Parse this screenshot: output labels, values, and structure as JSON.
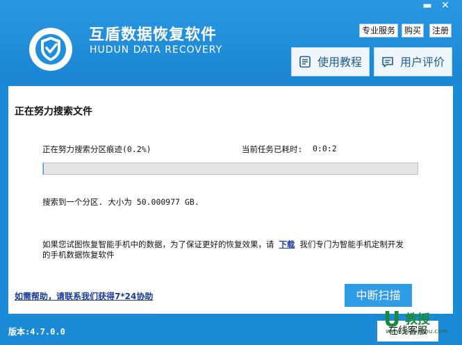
{
  "window": {
    "minimize": "▬",
    "close": "✕"
  },
  "header": {
    "app_name": "互盾数据恢复软件",
    "app_name_en": "HUDUN DATA RECOVERY",
    "links": [
      "专业服务",
      "购买",
      "注册"
    ],
    "tutorial_label": "使用教程",
    "review_label": "用户评价"
  },
  "panel": {
    "title": "正在努力搜索文件",
    "status": "正在努力搜索分区痕迹(0.2%)",
    "elapsed_label": "当前任务已耗时:",
    "elapsed_value": "0:0:2",
    "progress_percent": 0.2,
    "found": "搜索到一个分区. 大小为 50.000977 GB.",
    "mobile_msg_1": "如果您试图恢复智能手机中的数据，为了保证更好的恢复效果，请",
    "mobile_link": "下载",
    "mobile_msg_2": "我们专门为智能手机定制开发",
    "mobile_msg_3": "的手机数据恢复软件",
    "help_link": "如需帮助，请联系我们获得7*24协助",
    "stop_button": "中断扫描"
  },
  "footer": {
    "version": "版本:4.7.0.0",
    "online_service": "在线客服"
  },
  "watermark": {
    "u": "U",
    "text": "教授",
    "url": "www.ujiaoshou.com"
  },
  "colors": {
    "primary": "#1b8ad6",
    "button": "#2f9ce8",
    "link": "#1a3b9c"
  }
}
